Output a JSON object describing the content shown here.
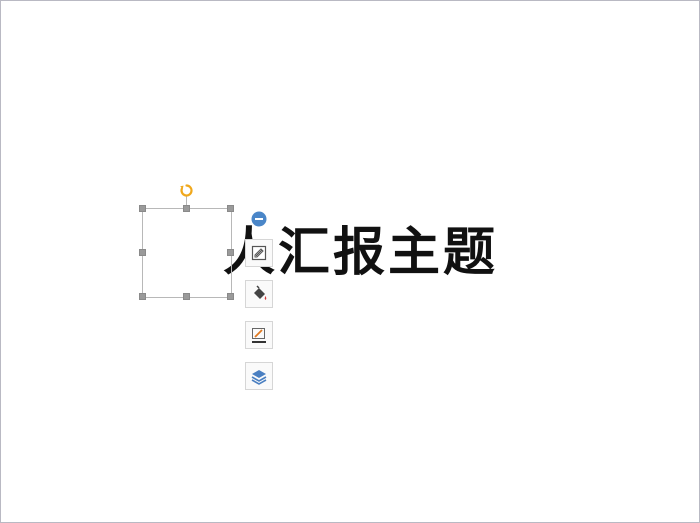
{
  "slide": {
    "title_text": "人汇报主题"
  },
  "selection": {
    "handles": [
      "top-left",
      "top-center",
      "top-right",
      "middle-left",
      "middle-right",
      "bottom-left",
      "bottom-center",
      "bottom-right"
    ]
  },
  "toolbar": {
    "buttons": [
      {
        "name": "shape-style-button",
        "icon": "shape-style-icon"
      },
      {
        "name": "fill-button",
        "icon": "paint-bucket-icon"
      },
      {
        "name": "outline-button",
        "icon": "pen-outline-icon"
      },
      {
        "name": "arrange-button",
        "icon": "layers-icon"
      }
    ]
  },
  "colors": {
    "rotate_handle": "#f0a81c",
    "collapse_button": "#4a86c8",
    "handle": "#9a9a9a",
    "selection_border": "#b8b8b8",
    "slide_border": "#b9b9c3",
    "text": "#111111"
  }
}
